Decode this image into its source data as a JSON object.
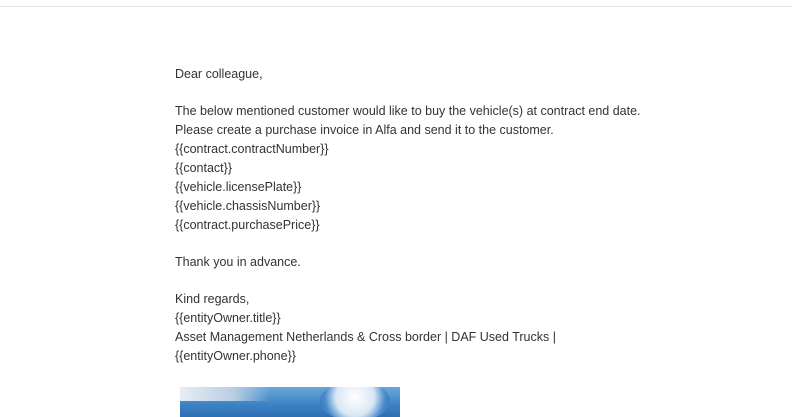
{
  "email": {
    "greeting": "Dear colleague,",
    "paragraph1": [
      "The below mentioned customer would like to buy the vehicle(s) at contract end date.",
      "Please create a purchase invoice in Alfa and send it to the customer."
    ],
    "placeholders": [
      "{{contract.contractNumber}}",
      "{{contact}}",
      "{{vehicle.licensePlate}}",
      "{{vehicle.chassisNumber}}",
      "{{contract.purchasePrice}}"
    ],
    "thanks": "Thank you in advance.",
    "closing": "Kind regards,",
    "signature": [
      "{{entityOwner.title}}",
      "Asset Management Netherlands & Cross border | DAF Used Trucks |",
      "{{entityOwner.phone}}"
    ]
  }
}
